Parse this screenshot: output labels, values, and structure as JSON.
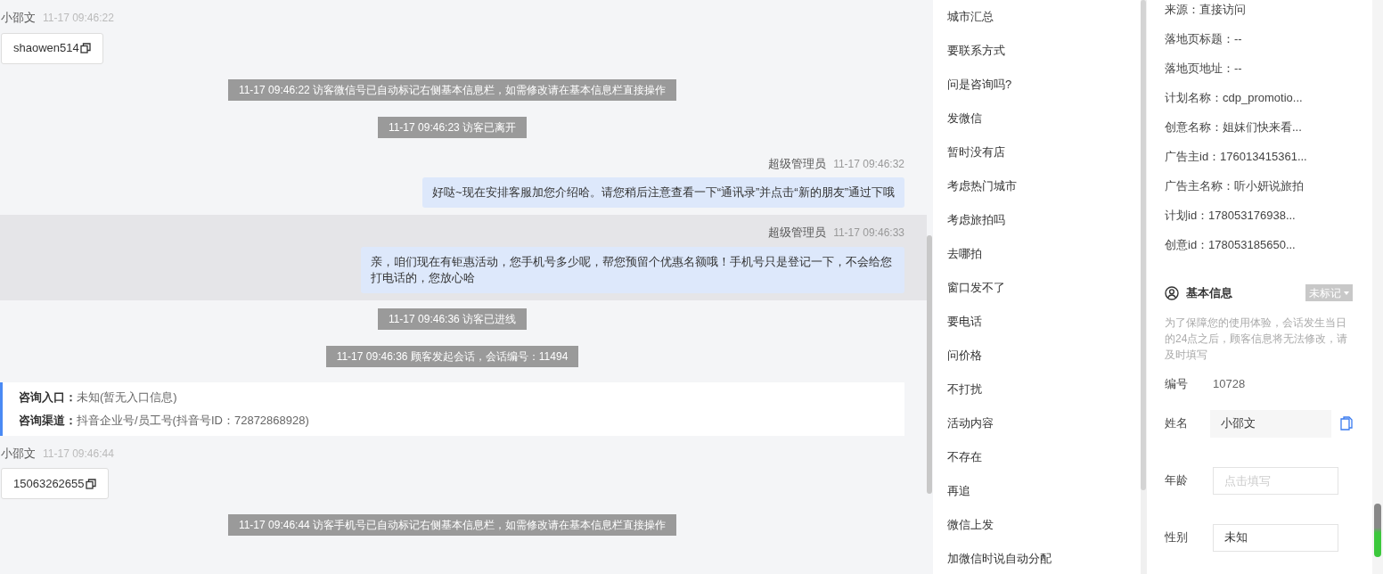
{
  "chat": {
    "messages": [
      {
        "kind": "visitor",
        "name": "小邵文",
        "time": "11-17 09:46:22",
        "content": "shaowen514"
      },
      {
        "kind": "system",
        "text": "11-17 09:46:22 访客微信号已自动标记右侧基本信息栏，如需修改请在基本信息栏直接操作"
      },
      {
        "kind": "system",
        "text": "11-17 09:46:23 访客已离开"
      },
      {
        "kind": "agent",
        "name": "超级管理员",
        "time": "11-17 09:46:32",
        "text": "好哒~现在安排客服加您介绍哈。请您稍后注意查看一下“通讯录”并点击“新的朋友”通过下哦",
        "highlighted": false
      },
      {
        "kind": "agent",
        "name": "超级管理员",
        "time": "11-17 09:46:33",
        "text": "亲，咱们现在有钜惠活动，您手机号多少呢，帮您预留个优惠名额哦！手机号只是登记一下，不会给您打电话的，您放心哈",
        "highlighted": true
      },
      {
        "kind": "system",
        "text": "11-17 09:46:36 访客已进线"
      },
      {
        "kind": "system",
        "text": "11-17 09:46:36 顾客发起会话，会话编号：11494"
      },
      {
        "kind": "info",
        "rows": [
          {
            "label": "咨询入口：",
            "value": "未知(暂无入口信息)"
          },
          {
            "label": "咨询渠道：",
            "value": "抖音企业号/员工号(抖音号ID：72872868928)"
          }
        ]
      },
      {
        "kind": "visitor",
        "name": "小邵文",
        "time": "11-17 09:46:44",
        "content": "15063262655"
      },
      {
        "kind": "system",
        "text": "11-17 09:46:44 访客手机号已自动标记右侧基本信息栏，如需修改请在基本信息栏直接操作"
      }
    ]
  },
  "quick_replies": [
    "城市汇总",
    "要联系方式",
    "问是咨询吗?",
    "发微信",
    "暂时没有店",
    "考虑热门城市",
    "考虑旅拍吗",
    "去哪拍",
    "窗口发不了",
    "要电话",
    "问价格",
    "不打扰",
    "活动内容",
    "不存在",
    "再追",
    "微信上发",
    "加微信时说自动分配"
  ],
  "visitor_source": [
    "来源：直接访问",
    "落地页标题：--",
    "落地页地址：--",
    "计划名称：cdp_promotio...",
    "创意名称：姐妹们快来看...",
    "广告主id：176013415361...",
    "广告主名称：听小妍说旅拍",
    "计划id：178053176938...",
    "创意id：178053185650..."
  ],
  "basic_info": {
    "title": "基本信息",
    "tag": "未标记",
    "notice": "为了保障您的使用体验，会话发生当日的24点之后，顾客信息将无法修改，请及时填写",
    "id_label": "编号",
    "id_value": "10728",
    "fields": [
      {
        "kind": "copyable",
        "label": "姓名",
        "value": "小邵文"
      },
      {
        "kind": "input",
        "label": "年龄",
        "placeholder": "点击填写"
      },
      {
        "kind": "input",
        "label": "性别",
        "value": "未知"
      }
    ]
  }
}
